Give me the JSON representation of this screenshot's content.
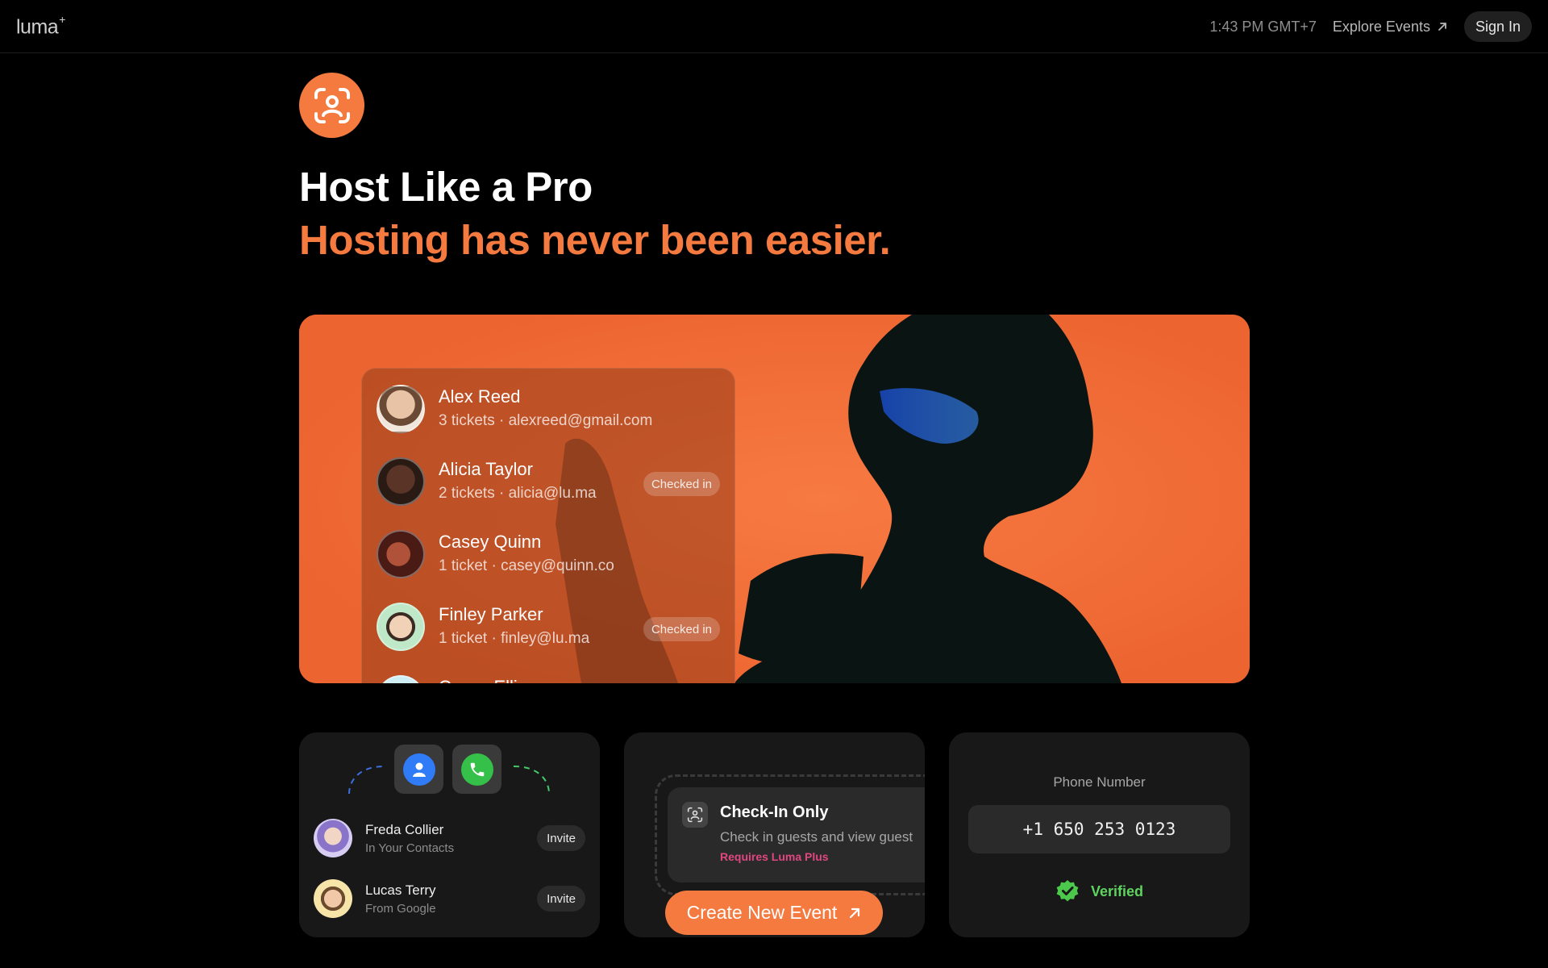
{
  "header": {
    "logo": "luma",
    "logo_mark": "+",
    "time": "1:43 PM GMT+7",
    "explore_label": "Explore Events",
    "signin_label": "Sign In"
  },
  "hero": {
    "icon": "face-scan-icon",
    "title": "Host Like a Pro",
    "subtitle": "Hosting has never been easier."
  },
  "banner": {
    "guests": [
      {
        "name": "Alex Reed",
        "meta": "3 tickets · alexreed@gmail.com",
        "badge": ""
      },
      {
        "name": "Alicia Taylor",
        "meta": "2 tickets · alicia@lu.ma",
        "badge": "Checked in"
      },
      {
        "name": "Casey Quinn",
        "meta": "1 ticket · casey@quinn.co",
        "badge": ""
      },
      {
        "name": "Finley Parker",
        "meta": "1 ticket · finley@lu.ma",
        "badge": "Checked in"
      },
      {
        "name": "Casey Elli",
        "meta": "",
        "badge": ""
      }
    ]
  },
  "invite_card": {
    "contacts": [
      {
        "name": "Freda Collier",
        "source": "In Your Contacts",
        "action": "Invite"
      },
      {
        "name": "Lucas Terry",
        "source": "From Google",
        "action": "Invite"
      }
    ]
  },
  "checkin_card": {
    "title": "Check-In Only",
    "description": "Check in guests and view guest",
    "requirement": "Requires Luma Plus",
    "button_label": "Create New Event"
  },
  "phone_card": {
    "label": "Phone Number",
    "value": "+1 650 253 0123",
    "status": "Verified"
  },
  "colors": {
    "accent": "#f47a40",
    "banner": "#f26b34",
    "verified": "#5fd35f",
    "plus": "#e0477f"
  }
}
